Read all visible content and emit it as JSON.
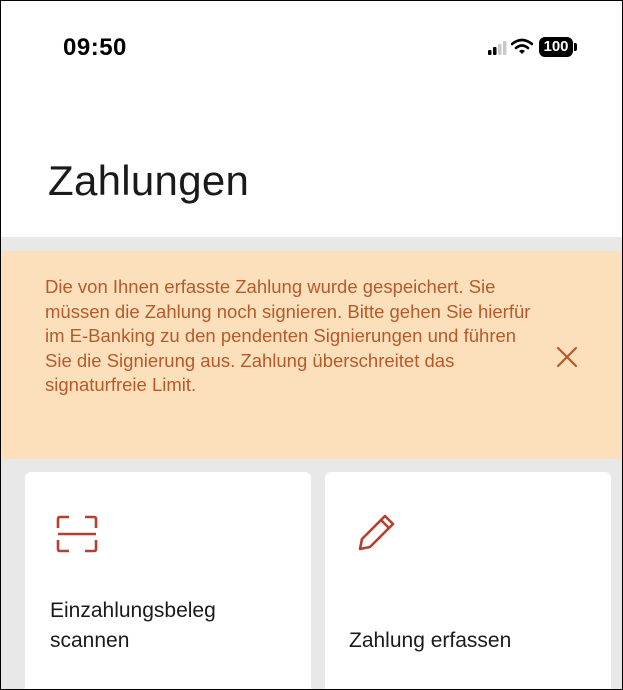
{
  "status_bar": {
    "time": "09:50",
    "battery": "100"
  },
  "header": {
    "title": "Zahlungen"
  },
  "notice": {
    "message": "Die von Ihnen erfasste Zahlung wurde gespeichert. Sie müssen die Zahlung noch signieren. Bitte gehen Sie hierfür im E-Banking zu den pendenten Signierungen und führen Sie die Signierung aus. Zahlung überschreitet das signaturfreie Limit.",
    "close_icon": "close-icon"
  },
  "actions": [
    {
      "label": "Einzahlungsbeleg scannen",
      "icon": "scan-icon"
    },
    {
      "label": "Zahlung erfassen",
      "icon": "pencil-icon"
    }
  ],
  "colors": {
    "notice_background": "#fbe0bb",
    "notice_text": "#b65a2c",
    "accent_icon": "#b5402f",
    "page_background": "#e8e8e8"
  }
}
